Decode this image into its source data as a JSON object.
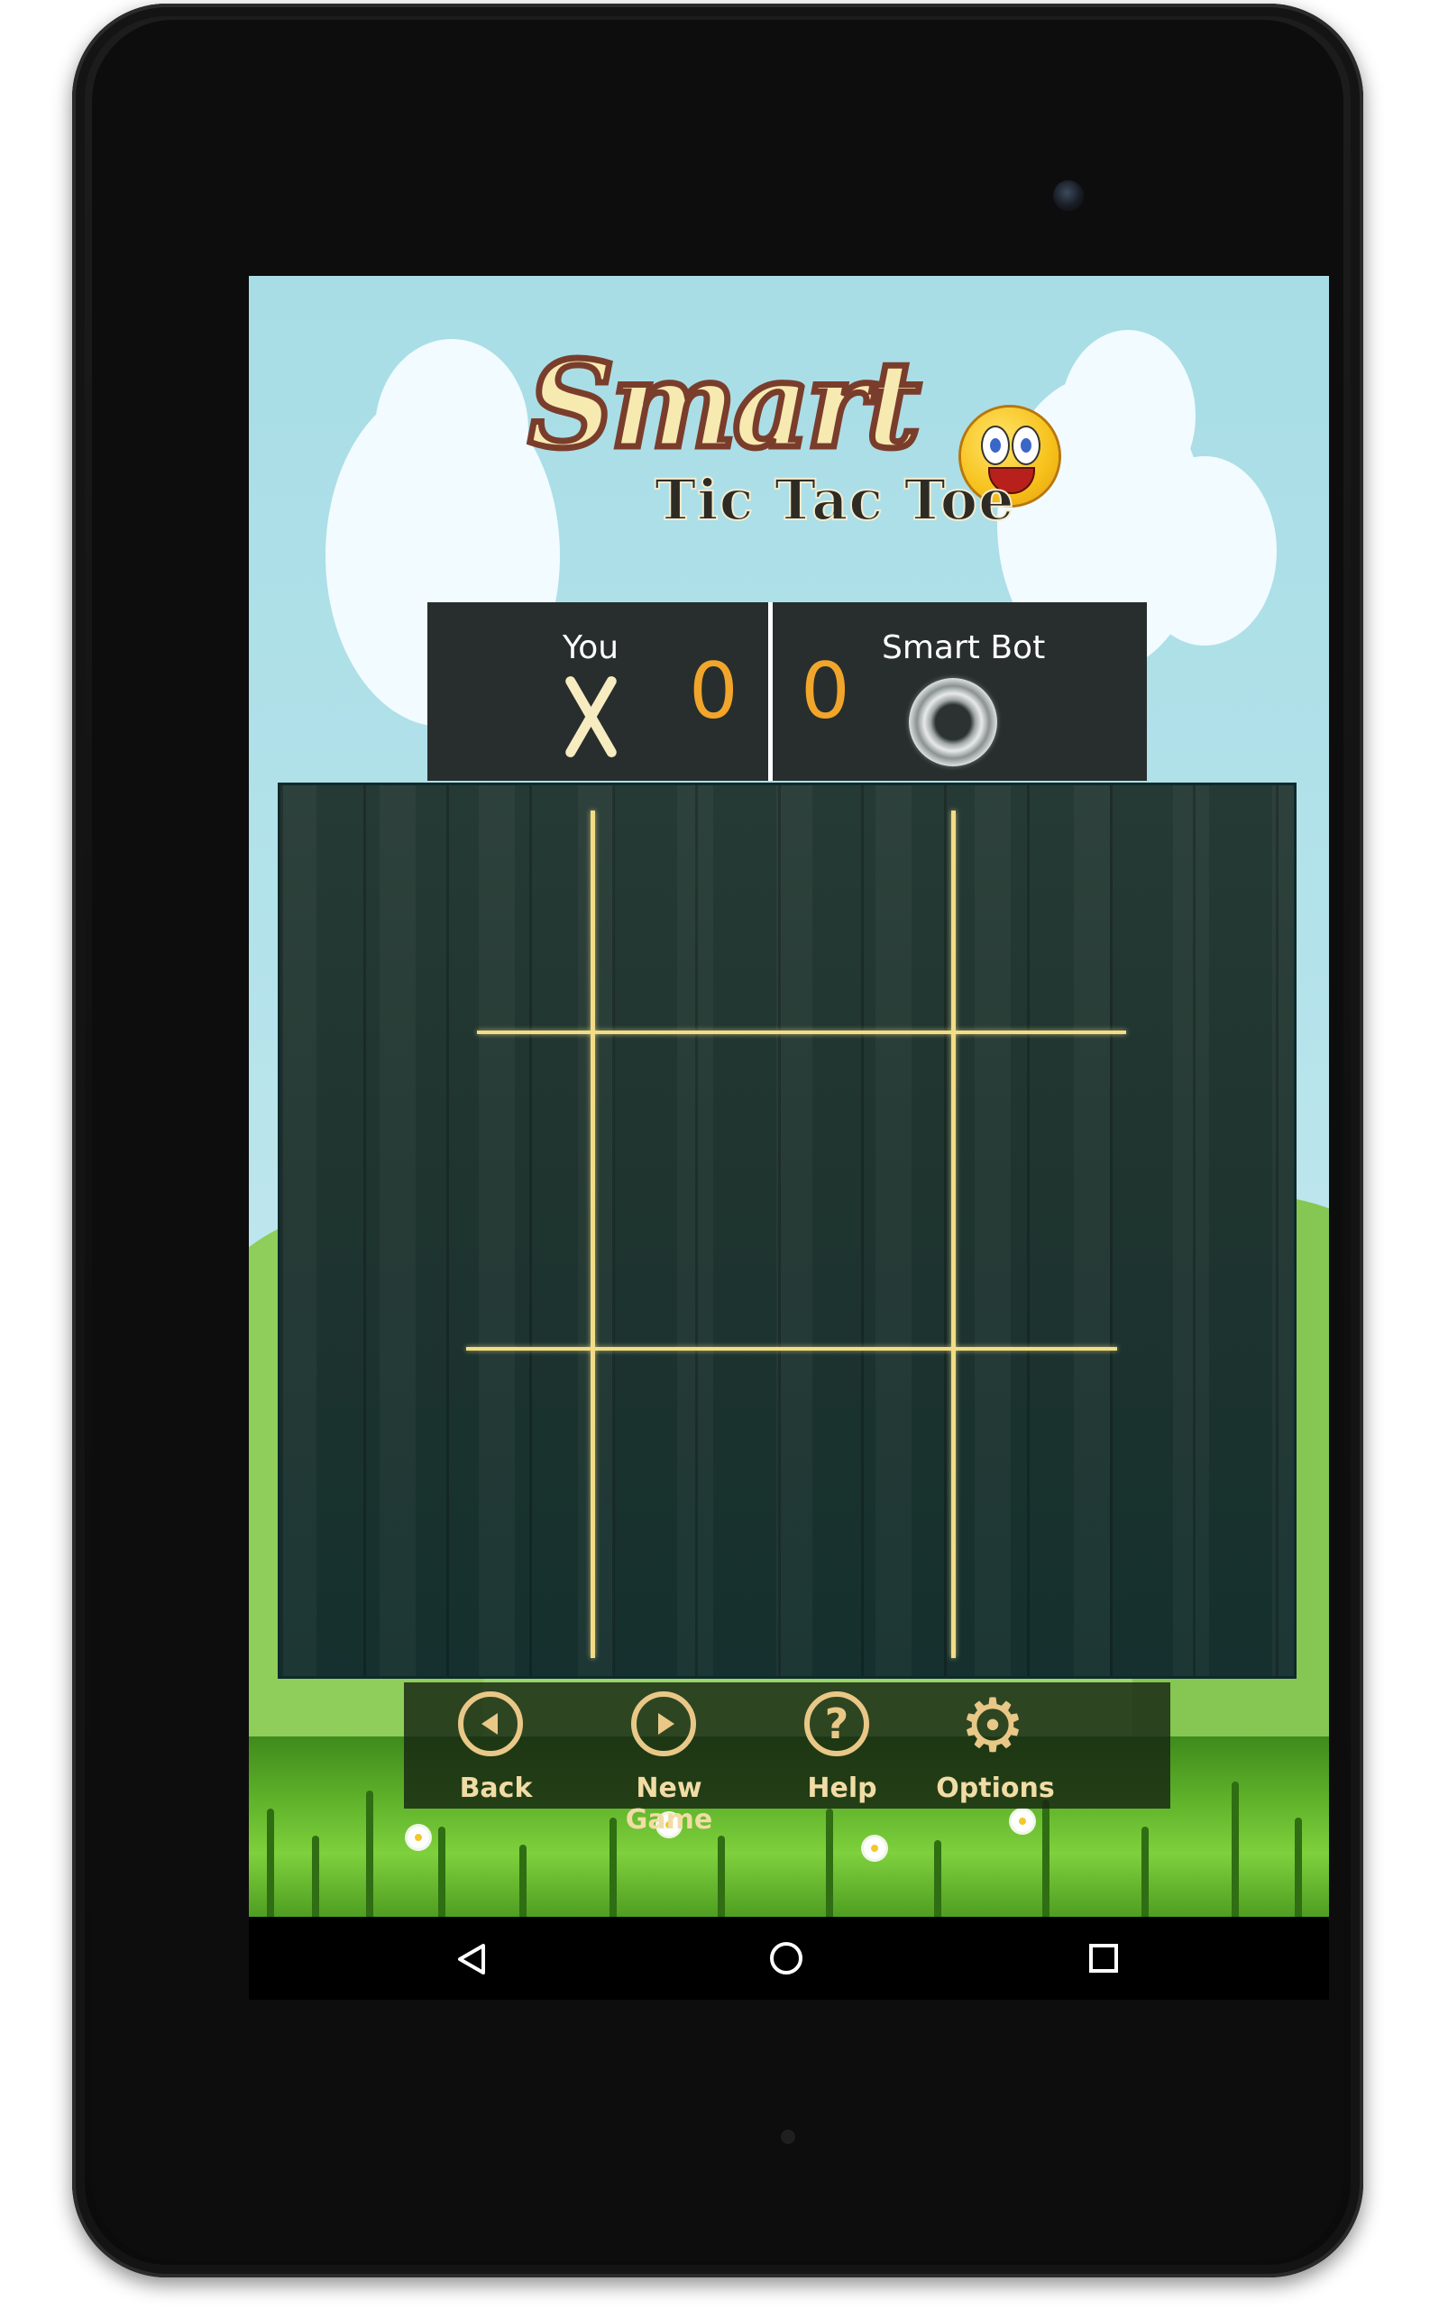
{
  "logo": {
    "title": "Smart",
    "subtitle": "Tic Tac Toe"
  },
  "score": {
    "player_label": "You",
    "player_symbol": "X",
    "player_score": "0",
    "bot_label": "Smart Bot",
    "bot_symbol": "O",
    "bot_score": "0"
  },
  "board": {
    "cells": [
      "",
      "",
      "",
      "",
      "",
      "",
      "",
      "",
      ""
    ]
  },
  "menu": {
    "back_label": "Back",
    "new_game_label": "New Game",
    "help_label": "Help",
    "help_glyph": "?",
    "options_label": "Options",
    "options_glyph": "⚙",
    "accent_color": "#e9c887"
  },
  "nav": {
    "back_icon": "back-triangle-icon",
    "home_icon": "home-circle-icon",
    "recents_icon": "recents-square-icon"
  }
}
